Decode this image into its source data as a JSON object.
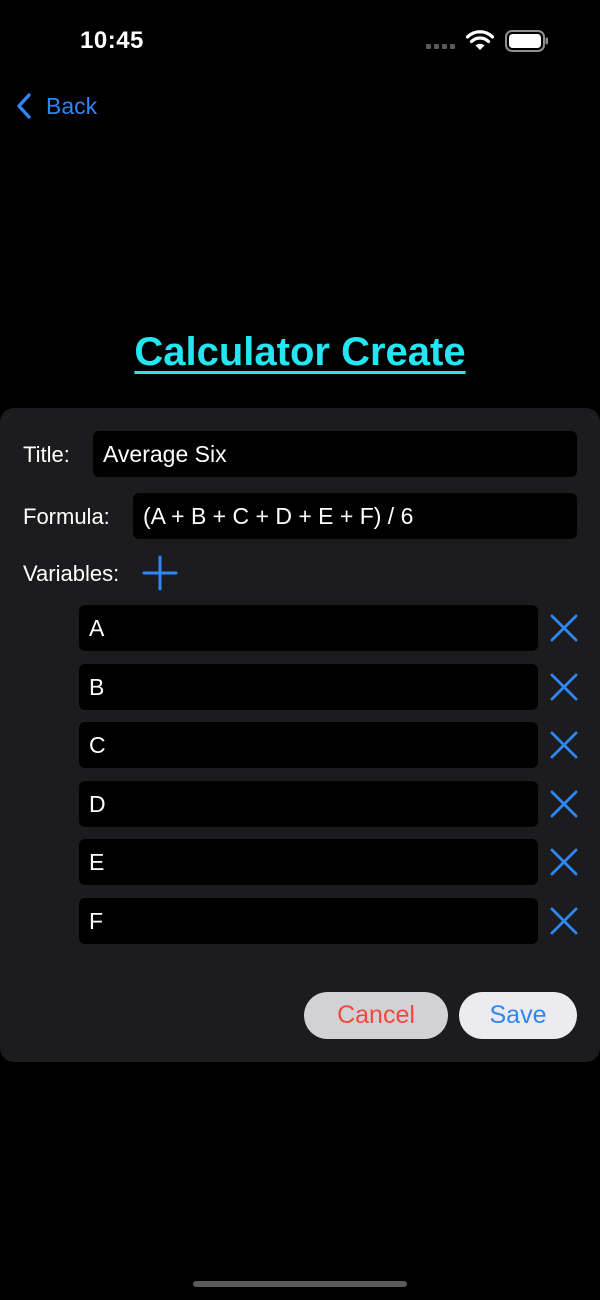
{
  "status_bar": {
    "time": "10:45"
  },
  "nav": {
    "back_label": "Back"
  },
  "page": {
    "title": "Calculator Create"
  },
  "form": {
    "title_label": "Title:",
    "title_value": "Average Six",
    "formula_label": "Formula:",
    "formula_value": "(A + B + C + D + E + F) / 6",
    "variables_label": "Variables:",
    "variables": [
      "A",
      "B",
      "C",
      "D",
      "E",
      "F"
    ],
    "cancel_label": "Cancel",
    "save_label": "Save"
  },
  "colors": {
    "accent": "#2f86f5",
    "title": "#22e6f2",
    "destructive": "#f04a3c",
    "card": "#1c1c1e"
  }
}
